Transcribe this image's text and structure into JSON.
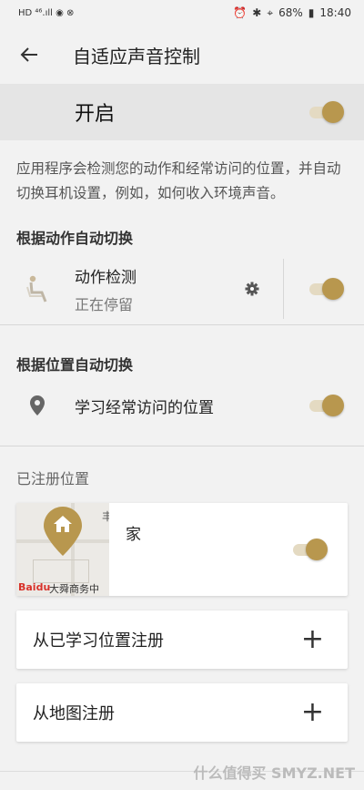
{
  "status": {
    "left": "HD ⁴⁶.ıll ◉ ⊗",
    "battery": "68%",
    "time": "18:40"
  },
  "appbar": {
    "title": "自适应声音控制"
  },
  "master": {
    "label": "开启",
    "enabled": true
  },
  "description": "应用程序会检测您的动作和经常访问的位置，并自动切换耳机设置，例如，如何收入环境声音。",
  "motion_section": {
    "heading": "根据动作自动切换",
    "item_title": "动作检测",
    "item_status": "正在停留",
    "enabled": true
  },
  "location_section": {
    "heading": "根据位置自动切换",
    "item_title": "学习经常访问的位置",
    "enabled": true
  },
  "registered": {
    "heading": "已注册位置",
    "home_name": "家",
    "map_label": "大舜商务中",
    "map_brand": "Baidu",
    "map_corner_char": "丰",
    "enabled": true
  },
  "actions": {
    "from_learned": "从已学习位置注册",
    "from_map": "从地图注册"
  },
  "watermark": "什么值得买 SMYZ.NET",
  "colors": {
    "accent": "#b8974e",
    "track": "#e4dac2"
  }
}
